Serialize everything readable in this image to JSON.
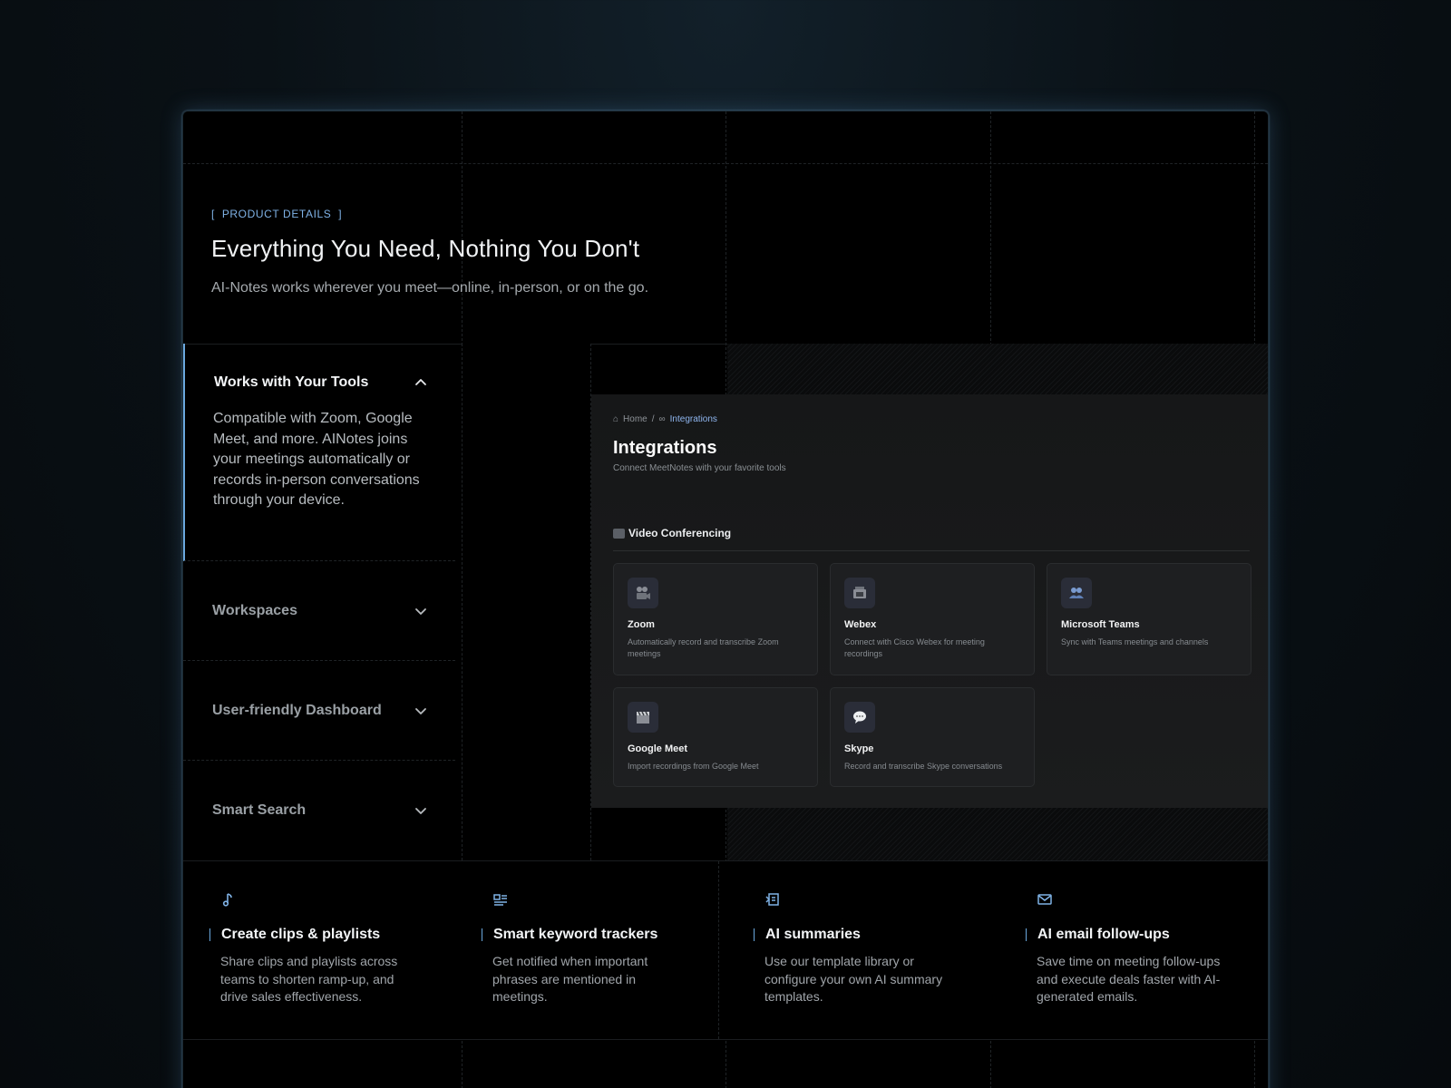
{
  "header": {
    "eyebrow": "PRODUCT DETAILS",
    "eyebrow_open": "[",
    "eyebrow_close": "]",
    "title": "Everything You Need, Nothing You Don't",
    "subtitle": "AI-Notes works wherever you meet—online, in-person, or on the go."
  },
  "accordion": [
    {
      "label": "Works with Your Tools",
      "expanded": true,
      "description": "Compatible with Zoom, Google Meet, and more. AINotes joins your meetings automatically or records in-person conversations through your device."
    },
    {
      "label": "Workspaces",
      "expanded": false
    },
    {
      "label": "User-friendly Dashboard",
      "expanded": false
    },
    {
      "label": "Smart Search",
      "expanded": false
    }
  ],
  "preview": {
    "breadcrumb": {
      "home": "Home",
      "separator": "/",
      "current": "Integrations"
    },
    "title": "Integrations",
    "subtitle": "Connect MeetNotes with your favorite tools",
    "section": "Video Conferencing",
    "cards": [
      {
        "name": "Zoom",
        "icon": "video-camera-icon",
        "description": "Automatically record and transcribe Zoom meetings"
      },
      {
        "name": "Webex",
        "icon": "film-projector-icon",
        "description": "Connect with Cisco Webex for meeting recordings"
      },
      {
        "name": "Microsoft Teams",
        "icon": "people-icon",
        "description": "Sync with Teams meetings and channels"
      },
      {
        "name": "Google Meet",
        "icon": "clapperboard-icon",
        "description": "Import recordings from Google Meet"
      },
      {
        "name": "Skype",
        "icon": "speech-bubble-icon",
        "description": "Record and transcribe Skype conversations"
      }
    ]
  },
  "features": [
    {
      "icon": "music-note-icon",
      "title": "Create clips & playlists",
      "description": "Share clips and playlists across teams to shorten ramp-up, and drive sales effectiveness."
    },
    {
      "icon": "news-tracker-icon",
      "title": "Smart keyword trackers",
      "description": "Get notified when important phrases are mentioned in meetings."
    },
    {
      "icon": "document-list-icon",
      "title": "AI summaries",
      "description": "Use our template library or configure your own AI summary templates."
    },
    {
      "icon": "mail-icon",
      "title": "AI email follow-ups",
      "description": "Save time on meeting follow-ups and execute deals faster with AI-generated emails."
    }
  ],
  "colors": {
    "accent": "#6aa8de",
    "background": "#000000",
    "card": "#1e1f21"
  }
}
